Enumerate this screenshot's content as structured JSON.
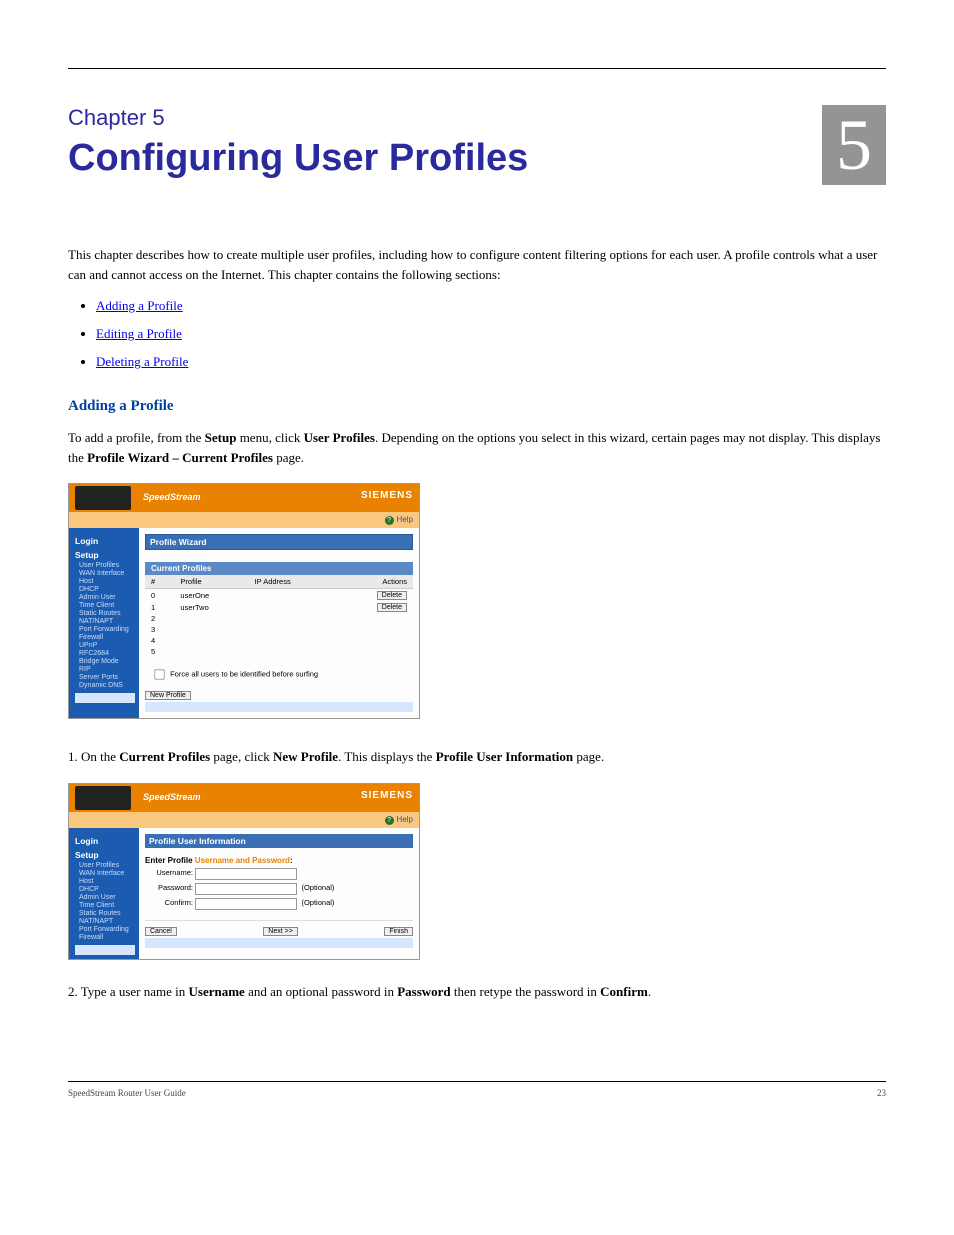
{
  "chapter": {
    "label": "Chapter 5",
    "title": "Configuring User Profiles",
    "number": "5"
  },
  "intro": "This chapter describes how to create multiple user profiles, including how to configure content filtering options for each user. A profile controls what a user can and cannot access on the Internet. This chapter contains the following sections:",
  "links": {
    "add": "Adding a Profile",
    "edit": "Editing a Profile",
    "delete": "Deleting a Profile"
  },
  "adding": {
    "heading": "Adding a Profile",
    "p1_a": "To add a profile, from the ",
    "p1_b": "Setup",
    "p1_c": " menu, click ",
    "p1_d": "User Profiles",
    "p1_e": ". Depending on the options you select in this wizard, certain pages may not display. This displays the ",
    "p1_f": "Profile Wizard – Current Profiles",
    "p1_g": " page.",
    "p2_a": "1.   On the ",
    "p2_b": "Current Profiles",
    "p2_c": " page, click ",
    "p2_d": "New Profile",
    "p2_e": ". This displays the ",
    "p2_f": "Profile User Information",
    "p2_g": " page.",
    "p3_a": "2.   Type a user name in ",
    "p3_b": "Username",
    "p3_c": "  and an optional password in ",
    "p3_d": "Password",
    "p3_e": " then retype the password in ",
    "p3_f": "Confirm",
    "p3_g": "."
  },
  "ss": {
    "product": "SpeedStream",
    "brand": "SIEMENS",
    "help": "Help",
    "login": "Login",
    "setup": "Setup",
    "side_items": [
      "User Profiles",
      "WAN Interface",
      "Host",
      "DHCP",
      "Admin User",
      "Time Client",
      "Static Routes",
      "NAT/NAPT",
      "Port Forwarding",
      "Firewall",
      "UPnP",
      "RFC2684",
      "Bridge Mode",
      "RIP",
      "Server Ports",
      "Dynamic DNS"
    ],
    "wiz1": "Profile Wizard",
    "cur": "Current Profiles",
    "cols": {
      "n": "#",
      "profile": "Profile",
      "ip": "IP Address",
      "actions": "Actions"
    },
    "rows": [
      {
        "n": "0",
        "profile": "userOne",
        "btn": "Delete"
      },
      {
        "n": "1",
        "profile": "userTwo",
        "btn": "Delete"
      },
      {
        "n": "2"
      },
      {
        "n": "3"
      },
      {
        "n": "4"
      },
      {
        "n": "5"
      }
    ],
    "force": "Force all users to be identified before surfing",
    "newp": "New Profile"
  },
  "ss2": {
    "wiz2": "Profile User Information",
    "prompt_a": "Enter Profile ",
    "prompt_b": "Username and Password",
    "prompt_c": ":",
    "u": "Username:",
    "p": "Password:",
    "c": "Confirm:",
    "opt": "(Optional)",
    "cancel": "Cancel",
    "next": "Next >>",
    "finish": "Finish",
    "side_items": [
      "User Profiles",
      "WAN Interface",
      "Host",
      "DHCP",
      "Admin User",
      "Time Client",
      "Static Routes",
      "NAT/NAPT",
      "Port Forwarding",
      "Firewall"
    ]
  },
  "footer": {
    "left": "SpeedStream Router User Guide",
    "right": "23"
  }
}
